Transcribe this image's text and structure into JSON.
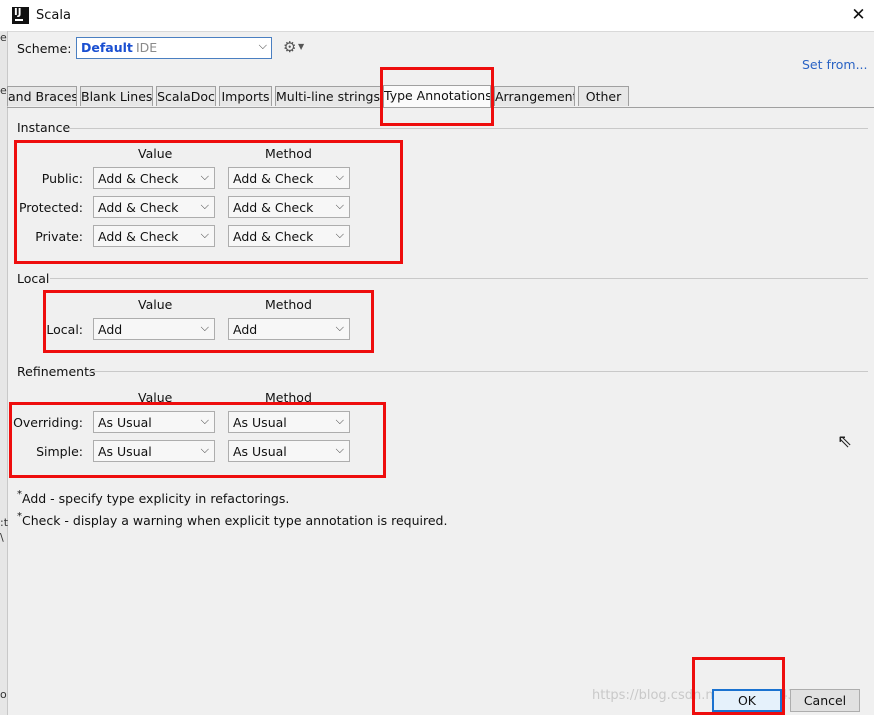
{
  "window": {
    "title": "Scala",
    "close_glyph": "✕"
  },
  "scheme": {
    "label": "Scheme:",
    "name": "Default",
    "kind": "IDE",
    "dropdown_glyph": "⌵"
  },
  "toolbar": {
    "gear_icon": "⚙",
    "gear_caret": "▼",
    "set_from_label": "Set from..."
  },
  "tabs": [
    {
      "label": "and Braces"
    },
    {
      "label": "Blank Lines"
    },
    {
      "label": "ScalaDoc"
    },
    {
      "label": "Imports"
    },
    {
      "label": "Multi-line strings"
    },
    {
      "label": "Type Annotations",
      "active": true
    },
    {
      "label": "Arrangement"
    },
    {
      "label": "Other"
    }
  ],
  "columns": {
    "value": "Value",
    "method": "Method"
  },
  "instance": {
    "label": "Instance",
    "rows": [
      {
        "label": "Public:",
        "value": "Add & Check",
        "method": "Add & Check"
      },
      {
        "label": "Protected:",
        "value": "Add & Check",
        "method": "Add & Check"
      },
      {
        "label": "Private:",
        "value": "Add & Check",
        "method": "Add & Check"
      }
    ]
  },
  "local": {
    "label": "Local",
    "rows": [
      {
        "label": "Local:",
        "value": "Add",
        "method": "Add"
      }
    ]
  },
  "refinements": {
    "label": "Refinements",
    "rows": [
      {
        "label": "Overriding:",
        "value": "As Usual",
        "method": "As Usual"
      },
      {
        "label": "Simple:",
        "value": "As Usual",
        "method": "As Usual"
      }
    ]
  },
  "notes": {
    "star": "*",
    "add": "Add - specify type explicity in refactorings.",
    "check": "Check - display a warning when explicit type annotation is required."
  },
  "buttons": {
    "ok": "OK",
    "cancel": "Cancel"
  },
  "watermark": "https://blog.csdn.net/weixin_43274409",
  "background_glyphs": [
    "e",
    "e",
    ":t",
    "\\",
    "o"
  ],
  "colors": {
    "highlight_box": "#ee0d0d",
    "link": "#2a63c4",
    "scheme_name": "#1a4fd1",
    "ok_border": "#1a72d0"
  }
}
